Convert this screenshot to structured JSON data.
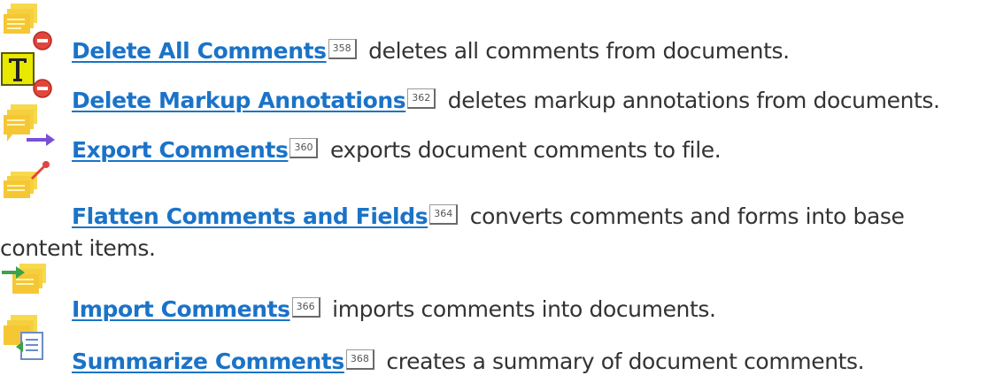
{
  "items": [
    {
      "icon": "delete-comments-icon",
      "link": "Delete All Comments",
      "page": "358",
      "desc": " deletes all comments from documents."
    },
    {
      "icon": "delete-markup-icon",
      "link": "Delete Markup Annotations",
      "page": "362",
      "desc": " deletes markup annotations from documents."
    },
    {
      "icon": "export-comments-icon",
      "link": "Export Comments",
      "page": "360",
      "desc": " exports document comments to file."
    },
    {
      "icon": "flatten-comments-icon",
      "link": "Flatten Comments and Fields",
      "page": "364",
      "desc": " converts comments and forms into base",
      "desc_cont": "content items."
    },
    {
      "icon": "import-comments-icon",
      "link": "Import Comments",
      "page": "366",
      "desc": " imports comments into documents."
    },
    {
      "icon": "summarize-comments-icon",
      "link": "Summarize Comments",
      "page": "368",
      "desc": " creates a summary of document comments."
    }
  ],
  "colors": {
    "link": "#1a73c8",
    "note_yellow": "#f7d94c",
    "note_orange": "#f0a23a",
    "delete_red": "#e0463c",
    "arrow_purple": "#7a4fd6",
    "arrow_green": "#3aa34a",
    "markup_yellow": "#e8e800"
  }
}
